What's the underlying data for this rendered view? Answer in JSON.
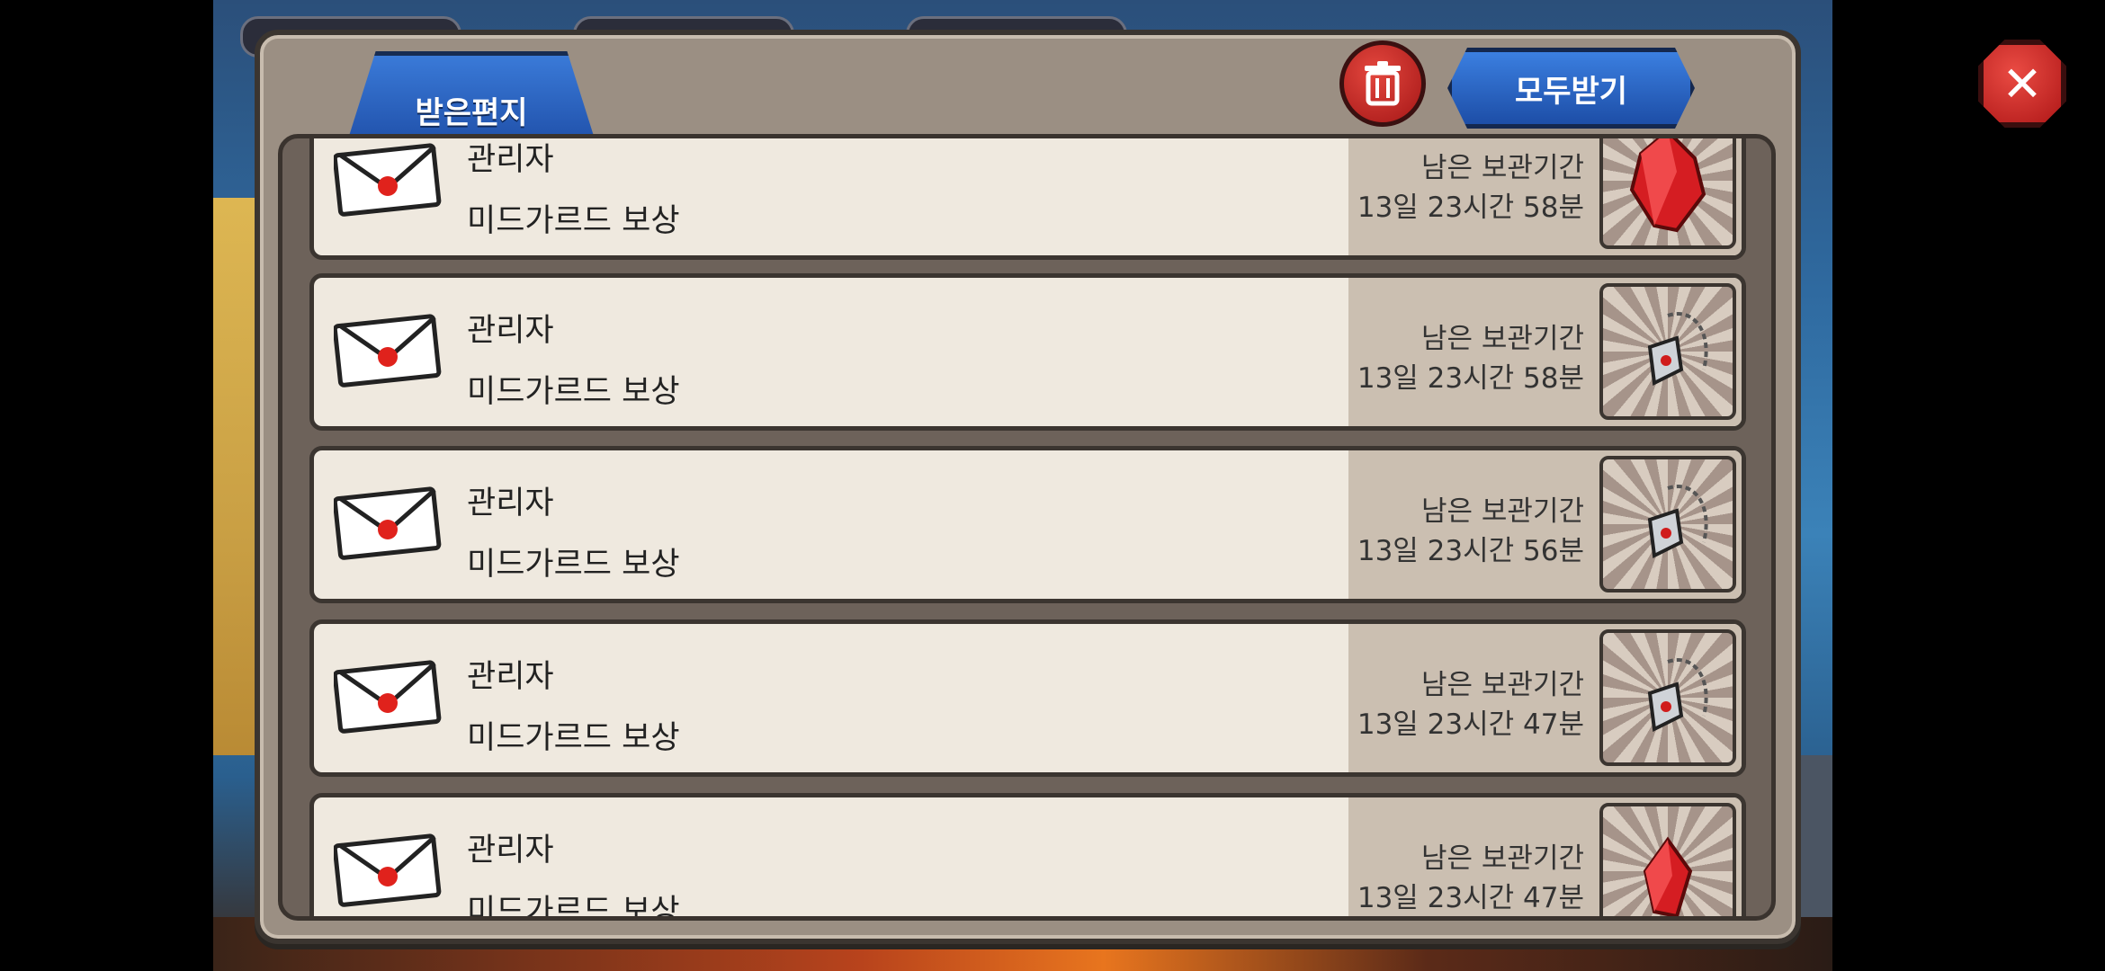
{
  "tab": {
    "inbox_label": "받은편지"
  },
  "toolbar": {
    "collect_all_label": "모두받기"
  },
  "colors": {
    "accent_blue": "#2b66c8",
    "danger_red": "#c4231f",
    "row_bg": "#efe9df",
    "row_right_bg": "#cbbfb1"
  },
  "mails": [
    {
      "sender": "관리자",
      "subject": "미드가르드 보상",
      "keep_label": "남은 보관기간",
      "keep_time": "13일 23시간 58분",
      "reward_icon": "red-crystal-icon"
    },
    {
      "sender": "관리자",
      "subject": "미드가르드 보상",
      "keep_label": "남은 보관기간",
      "keep_time": "13일 23시간 58분",
      "reward_icon": "silver-amulet-icon"
    },
    {
      "sender": "관리자",
      "subject": "미드가르드 보상",
      "keep_label": "남은 보관기간",
      "keep_time": "13일 23시간 56분",
      "reward_icon": "silver-amulet-icon"
    },
    {
      "sender": "관리자",
      "subject": "미드가르드 보상",
      "keep_label": "남은 보관기간",
      "keep_time": "13일 23시간 47분",
      "reward_icon": "silver-amulet-icon"
    },
    {
      "sender": "관리자",
      "subject": "미드가르드 보상",
      "keep_label": "남은 보관기간",
      "keep_time": "13일 23시간 47분",
      "reward_icon": "red-crystal-icon"
    }
  ]
}
